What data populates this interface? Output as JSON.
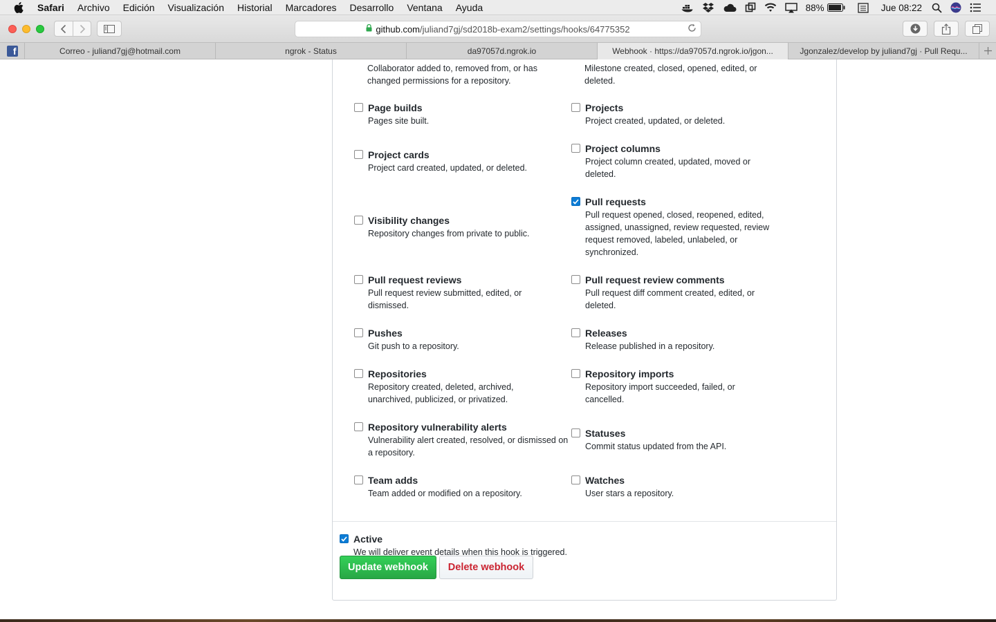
{
  "menubar": {
    "items": [
      "Safari",
      "Archivo",
      "Edición",
      "Visualización",
      "Historial",
      "Marcadores",
      "Desarrollo",
      "Ventana",
      "Ayuda"
    ],
    "battery": "88%",
    "clock": "Jue 08:22"
  },
  "toolbar": {
    "url_domain": "github.com",
    "url_path": "/juliand7gj/sd2018b-exam2/settings/hooks/64775352"
  },
  "tabs": [
    "Correo - juliand7gj@hotmail.com",
    "ngrok - Status",
    "da97057d.ngrok.io",
    "Webhook · https://da97057d.ngrok.io/jgon...",
    "Jgonzalez/develop by juliand7gj · Pull Requ..."
  ],
  "cut_off": {
    "left_desc": "Collaborator added to, removed from, or has changed permissions for a repository.",
    "right_desc": "Milestone created, closed, opened, edited, or deleted."
  },
  "events": [
    {
      "name": "Page builds",
      "desc": "Pages site built.",
      "checked": false
    },
    {
      "name": "Projects",
      "desc": "Project created, updated, or deleted.",
      "checked": false
    },
    {
      "name": "Project cards",
      "desc": "Project card created, updated, or deleted.",
      "checked": false
    },
    {
      "name": "Project columns",
      "desc": "Project column created, updated, moved or deleted.",
      "checked": false
    },
    {
      "name": "Visibility changes",
      "desc": "Repository changes from private to public.",
      "checked": false
    },
    {
      "name": "Pull requests",
      "desc": "Pull request opened, closed, reopened, edited, assigned, unassigned, review requested, review request removed, labeled, unlabeled, or synchronized.",
      "checked": true
    },
    {
      "name": "Pull request reviews",
      "desc": "Pull request review submitted, edited, or dismissed.",
      "checked": false
    },
    {
      "name": "Pull request review comments",
      "desc": "Pull request diff comment created, edited, or deleted.",
      "checked": false
    },
    {
      "name": "Pushes",
      "desc": "Git push to a repository.",
      "checked": false
    },
    {
      "name": "Releases",
      "desc": "Release published in a repository.",
      "checked": false
    },
    {
      "name": "Repositories",
      "desc": "Repository created, deleted, archived, unarchived, publicized, or privatized.",
      "checked": false
    },
    {
      "name": "Repository imports",
      "desc": "Repository import succeeded, failed, or cancelled.",
      "checked": false
    },
    {
      "name": "Repository vulnerability alerts",
      "desc": "Vulnerability alert created, resolved, or dismissed on a repository.",
      "checked": false
    },
    {
      "name": "Statuses",
      "desc": "Commit status updated from the API.",
      "checked": false
    },
    {
      "name": "Team adds",
      "desc": "Team added or modified on a repository.",
      "checked": false
    },
    {
      "name": "Watches",
      "desc": "User stars a repository.",
      "checked": false
    }
  ],
  "active": {
    "label": "Active",
    "desc": "We will deliver event details when this hook is triggered.",
    "checked": true
  },
  "buttons": {
    "update": "Update webhook",
    "delete": "Delete webhook"
  },
  "colors": {
    "update_button": "#28a745",
    "delete_text": "#cb2431",
    "checkbox_checked": "#0c7cd5"
  }
}
